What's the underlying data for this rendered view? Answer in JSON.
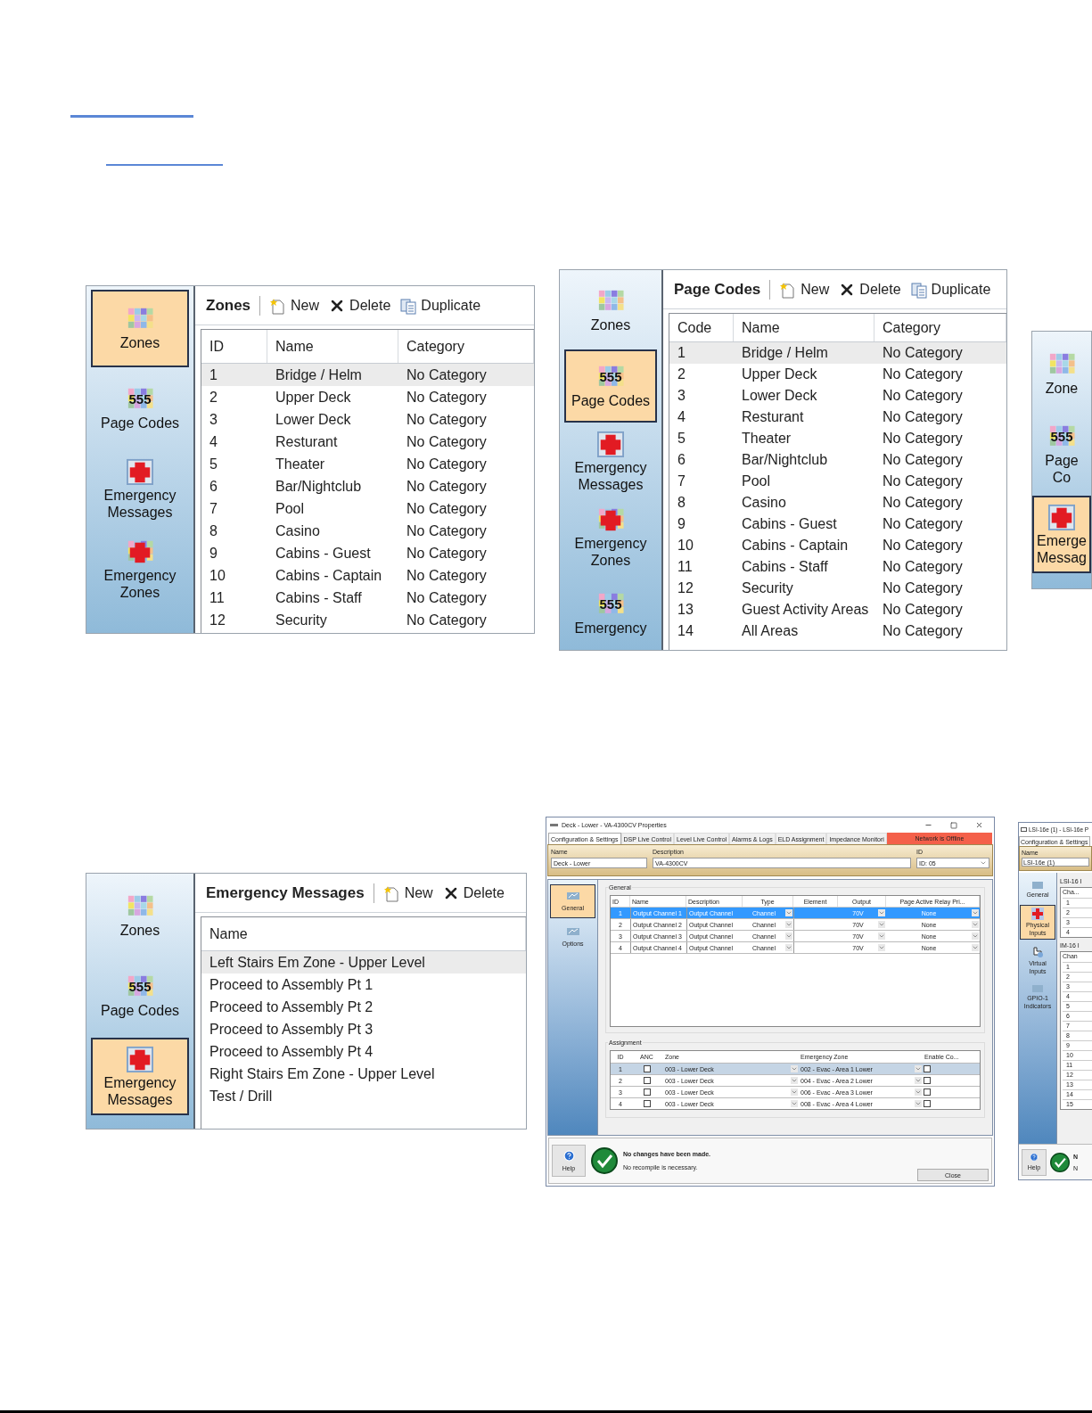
{
  "list_panels": [
    {
      "sidebar": [
        {
          "label": "Zones",
          "kind": "grid",
          "selected": true
        },
        {
          "label": "Page Codes",
          "kind": "grid",
          "icon_text": "555",
          "selected": false
        },
        {
          "label": "Emergency Messages",
          "kind": "cross",
          "selected": false
        },
        {
          "label": "Emergency Zones",
          "kind": "grid_cross",
          "selected": false
        }
      ],
      "title": "Zones",
      "toolbar": [
        {
          "label": "New",
          "kind": "new"
        },
        {
          "label": "Delete",
          "kind": "delete"
        },
        {
          "label": "Duplicate",
          "kind": "duplicate"
        }
      ],
      "columns": [
        "ID",
        "Name",
        "Category"
      ],
      "rows": [
        {
          "cells": [
            "1",
            "Bridge / Helm",
            "No Category"
          ],
          "selected": true
        },
        {
          "cells": [
            "2",
            "Upper Deck",
            "No Category"
          ],
          "selected": false
        },
        {
          "cells": [
            "3",
            "Lower Deck",
            "No Category"
          ],
          "selected": false
        },
        {
          "cells": [
            "4",
            "Resturant",
            "No Category"
          ],
          "selected": false
        },
        {
          "cells": [
            "5",
            "Theater",
            "No Category"
          ],
          "selected": false
        },
        {
          "cells": [
            "6",
            "Bar/Nightclub",
            "No Category"
          ],
          "selected": false
        },
        {
          "cells": [
            "7",
            "Pool",
            "No Category"
          ],
          "selected": false
        },
        {
          "cells": [
            "8",
            "Casino",
            "No Category"
          ],
          "selected": false
        },
        {
          "cells": [
            "9",
            "Cabins - Guest",
            "No Category"
          ],
          "selected": false
        },
        {
          "cells": [
            "10",
            "Cabins - Captain",
            "No Category"
          ],
          "selected": false
        },
        {
          "cells": [
            "11",
            "Cabins - Staff",
            "No Category"
          ],
          "selected": false
        },
        {
          "cells": [
            "12",
            "Security",
            "No Category"
          ],
          "selected": false
        }
      ]
    },
    {
      "sidebar": [
        {
          "label": "Zones",
          "kind": "grid",
          "selected": false
        },
        {
          "label": "Page Codes",
          "kind": "grid",
          "icon_text": "555",
          "selected": true
        },
        {
          "label": "Emergency Messages",
          "kind": "cross",
          "selected": false
        },
        {
          "label": "Emergency Zones",
          "kind": "grid_cross",
          "selected": false
        },
        {
          "label": "Emergency",
          "kind": "grid",
          "icon_text": "555",
          "selected": false
        }
      ],
      "title": "Page Codes",
      "toolbar": [
        {
          "label": "New",
          "kind": "new"
        },
        {
          "label": "Delete",
          "kind": "delete"
        },
        {
          "label": "Duplicate",
          "kind": "duplicate"
        }
      ],
      "columns": [
        "Code",
        "Name",
        "Category"
      ],
      "rows": [
        {
          "cells": [
            "1",
            "Bridge / Helm",
            "No Category"
          ],
          "selected": true
        },
        {
          "cells": [
            "2",
            "Upper Deck",
            "No Category"
          ],
          "selected": false
        },
        {
          "cells": [
            "3",
            "Lower Deck",
            "No Category"
          ],
          "selected": false
        },
        {
          "cells": [
            "4",
            "Resturant",
            "No Category"
          ],
          "selected": false
        },
        {
          "cells": [
            "5",
            "Theater",
            "No Category"
          ],
          "selected": false
        },
        {
          "cells": [
            "6",
            "Bar/Nightclub",
            "No Category"
          ],
          "selected": false
        },
        {
          "cells": [
            "7",
            "Pool",
            "No Category"
          ],
          "selected": false
        },
        {
          "cells": [
            "8",
            "Casino",
            "No Category"
          ],
          "selected": false
        },
        {
          "cells": [
            "9",
            "Cabins - Guest",
            "No Category"
          ],
          "selected": false
        },
        {
          "cells": [
            "10",
            "Cabins - Captain",
            "No Category"
          ],
          "selected": false
        },
        {
          "cells": [
            "11",
            "Cabins - Staff",
            "No Category"
          ],
          "selected": false
        },
        {
          "cells": [
            "12",
            "Security",
            "No Category"
          ],
          "selected": false
        },
        {
          "cells": [
            "13",
            "Guest Activity Areas",
            "No Category"
          ],
          "selected": false
        },
        {
          "cells": [
            "14",
            "All Areas",
            "No Category"
          ],
          "selected": false
        }
      ]
    },
    {
      "sidebar": [
        {
          "label": "Zone",
          "kind": "grid",
          "selected": false
        },
        {
          "label": "Page Co",
          "kind": "grid",
          "icon_text": "555",
          "selected": false
        },
        {
          "label": "Emerge Messag",
          "kind": "cross",
          "selected": true
        }
      ]
    },
    {
      "sidebar": [
        {
          "label": "Zones",
          "kind": "grid",
          "selected": false
        },
        {
          "label": "Page Codes",
          "kind": "grid",
          "icon_text": "555",
          "selected": false
        },
        {
          "label": "Emergency Messages",
          "kind": "cross",
          "selected": true
        }
      ],
      "title": "Emergency Messages",
      "toolbar": [
        {
          "label": "New",
          "kind": "new"
        },
        {
          "label": "Delete",
          "kind": "delete"
        }
      ],
      "columns": [
        "Name"
      ],
      "rows": [
        {
          "cells": [
            "Left Stairs Em Zone - Upper Level"
          ],
          "selected": true
        },
        {
          "cells": [
            "Proceed to Assembly Pt 1"
          ],
          "selected": false
        },
        {
          "cells": [
            "Proceed to Assembly Pt 2"
          ],
          "selected": false
        },
        {
          "cells": [
            "Proceed to Assembly Pt 3"
          ],
          "selected": false
        },
        {
          "cells": [
            "Proceed to Assembly Pt 4"
          ],
          "selected": false
        },
        {
          "cells": [
            "Right Stairs Em Zone - Upper Level"
          ],
          "selected": false
        },
        {
          "cells": [
            "Test / Drill"
          ],
          "selected": false
        }
      ]
    }
  ],
  "properties_window": {
    "title": "Deck - Lower - VA-4300CV Properties",
    "tabs": [
      {
        "label": "Configuration & Settings",
        "selected": true
      },
      {
        "label": "DSP Live Control",
        "selected": false
      },
      {
        "label": "Level Live Control",
        "selected": false
      },
      {
        "label": "Alarms & Logs",
        "selected": false
      },
      {
        "label": "ELD Assignment",
        "selected": false
      },
      {
        "label": "Impedance Monitori",
        "selected": false
      }
    ],
    "network_status": "Network is Offline",
    "fields": [
      {
        "label": "Name",
        "value": "Deck - Lower"
      },
      {
        "label": "Description",
        "value": "VA-4300CV"
      }
    ],
    "id_field": {
      "label": "ID",
      "value": "ID: 05"
    },
    "nav": [
      {
        "label": "General",
        "selected": true
      },
      {
        "label": "Options",
        "selected": false
      }
    ],
    "general": {
      "title": "General",
      "columns": [
        "ID",
        "Name",
        "Description",
        "Type",
        "Element",
        "Output",
        "Page Active Relay Pri..."
      ],
      "rows": [
        {
          "id": "1",
          "name": "Output Channel 1",
          "description": "Output Channel",
          "type": "Channel",
          "output": "70V",
          "relay": "None",
          "selected": true
        },
        {
          "id": "2",
          "name": "Output Channel 2",
          "description": "Output Channel",
          "type": "Channel",
          "output": "70V",
          "relay": "None",
          "selected": false
        },
        {
          "id": "3",
          "name": "Output Channel 3",
          "description": "Output Channel",
          "type": "Channel",
          "output": "70V",
          "relay": "None",
          "selected": false
        },
        {
          "id": "4",
          "name": "Output Channel 4",
          "description": "Output Channel",
          "type": "Channel",
          "output": "70V",
          "relay": "None",
          "selected": false
        }
      ]
    },
    "assignment": {
      "title": "Assignment",
      "columns": [
        "ID",
        "ANC",
        "Zone",
        "Emergency Zone",
        "Enable Co..."
      ],
      "rows": [
        {
          "id": "1",
          "anc": false,
          "zone": "003 - Lower Deck",
          "emergency_zone": "002 - Evac - Area 1 Lower",
          "enable": false,
          "selected": true
        },
        {
          "id": "2",
          "anc": false,
          "zone": "003 - Lower Deck",
          "emergency_zone": "004 - Evac - Area 2 Lower",
          "enable": false,
          "selected": false
        },
        {
          "id": "3",
          "anc": false,
          "zone": "003 - Lower Deck",
          "emergency_zone": "006 - Evac - Area 3 Lower",
          "enable": false,
          "selected": false
        },
        {
          "id": "4",
          "anc": false,
          "zone": "003 - Lower Deck",
          "emergency_zone": "008 - Evac - Area 4 Lower",
          "enable": false,
          "selected": false
        }
      ]
    },
    "status_title": "No changes have been made.",
    "status_message": "No recompile is necessary.",
    "help": "Help",
    "close": "Close"
  },
  "lsi_window": {
    "title": "LSI-16e (1) - LSI-16e P",
    "tab": "Configuration & Settings",
    "field_label": "Name",
    "field_value": "LSI-16e (1)",
    "nav": [
      {
        "label": "General",
        "kind": "device",
        "selected": false
      },
      {
        "label": "Physical Inputs",
        "kind": "cross",
        "selected": true
      },
      {
        "label": "Virtual Inputs",
        "kind": "hand",
        "selected": false
      },
      {
        "label": "GPIO-1 Indicators",
        "kind": "device",
        "selected": false
      }
    ],
    "groups": [
      {
        "title": "LSI-16 I",
        "header": "Cha...",
        "rows": [
          "1",
          "2",
          "3",
          "4"
        ]
      },
      {
        "title": "IM-16 I",
        "header": "Chan",
        "rows": [
          "1",
          "2",
          "3",
          "4",
          "5",
          "6",
          "7",
          "8",
          "9",
          "10",
          "11",
          "12",
          "13",
          "14",
          "15"
        ]
      }
    ],
    "help": "Help",
    "status_lines": [
      "N",
      "N"
    ]
  }
}
